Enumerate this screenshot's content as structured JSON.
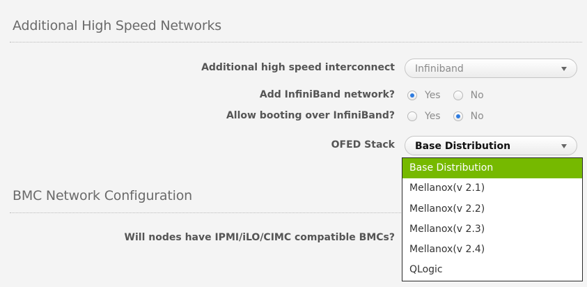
{
  "sections": {
    "high_speed_title": "Additional High Speed Networks",
    "bmc_title": "BMC Network Configuration"
  },
  "interconnect": {
    "label": "Additional high speed interconnect",
    "value": "Infiniband"
  },
  "add_infiniband": {
    "label": "Add InfiniBand network?",
    "yes_label": "Yes",
    "no_label": "No",
    "selected": "Yes"
  },
  "allow_booting": {
    "label": "Allow booting over InfiniBand?",
    "yes_label": "Yes",
    "no_label": "No",
    "selected": "No"
  },
  "ofed": {
    "label": "OFED Stack",
    "value": "Base Distribution",
    "options": [
      "Base Distribution",
      "Mellanox(v 2.1)",
      "Mellanox(v 2.2)",
      "Mellanox(v 2.3)",
      "Mellanox(v 2.4)",
      "QLogic"
    ],
    "highlighted": "Base Distribution"
  },
  "bmc": {
    "label": "Will nodes have IPMI/iLO/CIMC compatible BMCs?"
  },
  "colors": {
    "highlight": "#76b900",
    "radio_dot": "#2f7ce0",
    "background": "#f4f4f4"
  }
}
